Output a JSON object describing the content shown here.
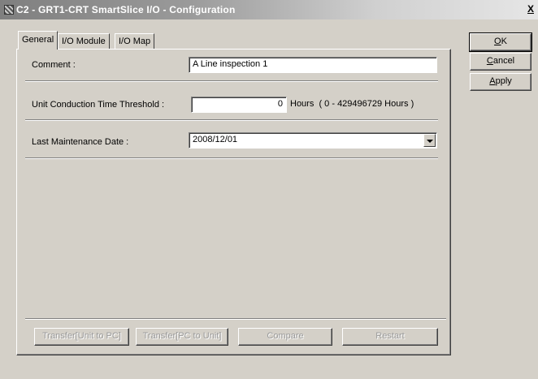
{
  "window": {
    "title": "C2 - GRT1-CRT SmartSlice I/O - Configuration",
    "close_label": "X"
  },
  "tabs": [
    {
      "label": "General",
      "active": true
    },
    {
      "label": "I/O Module",
      "active": false
    },
    {
      "label": "I/O Map",
      "active": false
    }
  ],
  "general": {
    "comment_label": "Comment :",
    "comment_value": "A Line inspection 1",
    "threshold_label": "Unit Conduction Time Threshold :",
    "threshold_value": "0",
    "threshold_unit": "Hours  ( 0 - 429496729 Hours )",
    "maintenance_label": "Last Maintenance Date :",
    "maintenance_value": "2008/12/01"
  },
  "bottom_buttons": {
    "transfer_unit_to_pc": "Transfer[Unit to PC]",
    "transfer_pc_to_unit": "Transfer[PC to Unit]",
    "compare": "Compare",
    "restart": "Restart"
  },
  "side_buttons": {
    "ok_first": "O",
    "ok_rest": "K",
    "cancel_first": "C",
    "cancel_rest": "ancel",
    "apply_first": "A",
    "apply_rest": "pply"
  }
}
